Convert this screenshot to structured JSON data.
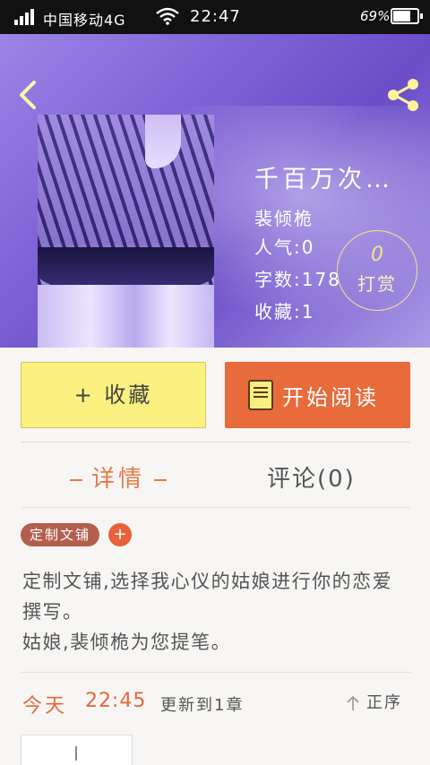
{
  "status_bar": {
    "carrier": "中国移动4G",
    "time": "22:47",
    "battery": "69%"
  },
  "book": {
    "title": "千百万次…",
    "author": "裴倾桅",
    "popularity": "人气:0",
    "words": "字数:178",
    "favorites": "收藏:1"
  },
  "tip": {
    "count": "0",
    "label": "打赏"
  },
  "actions": {
    "collect_label": "+ 收藏",
    "read_label": "开始阅读"
  },
  "tabs": {
    "detail": "详情",
    "comments": "评论(0)"
  },
  "tag": {
    "label": "定制文铺",
    "add": "+"
  },
  "description": {
    "line1": "定制文铺,选择我心仪的姑娘进行你的恋爱撰写。",
    "line2": "姑娘,裴倾桅为您提笔。"
  },
  "update": {
    "day": "今天",
    "time": "22:45",
    "text": "更新到1章",
    "sort_label": "正序"
  },
  "colors": {
    "accent": "#e76b3b",
    "collect_bg": "#fbf180",
    "header_purple": "#7e62d6"
  },
  "icons": {
    "back": "back-arrow-icon",
    "share": "share-icon",
    "read": "book-icon",
    "sort": "sort-up-arrow-icon"
  }
}
